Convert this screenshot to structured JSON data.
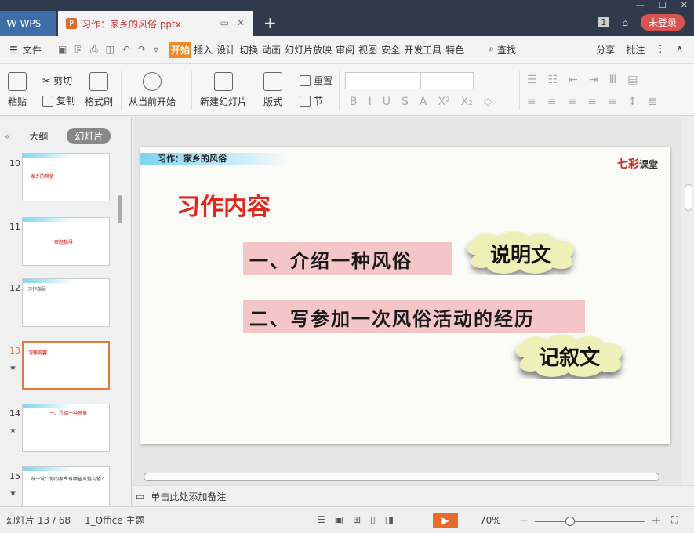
{
  "titlebar": {
    "app_tab": "WPS",
    "doc_tab": "习作：家乡的风俗.pptx",
    "badge": "1",
    "login": "未登录"
  },
  "menu": {
    "file": "文件",
    "tabs": [
      "开始",
      "插入",
      "设计",
      "切换",
      "动画",
      "幻灯片放映",
      "审阅",
      "视图",
      "安全",
      "开发工具",
      "特色"
    ],
    "active_tab": "开始",
    "find": "查找",
    "share": "分享",
    "comment": "批注"
  },
  "ribbon": {
    "paste": "粘贴",
    "cut": "剪切",
    "copy": "复制",
    "format_painter": "格式刷",
    "from_current": "从当前开始",
    "new_slide": "新建幻灯片",
    "layout": "版式",
    "reset": "重置",
    "section": "节"
  },
  "left_panel": {
    "tab_outline": "大纲",
    "tab_slides": "幻灯片",
    "thumbnails": [
      {
        "num": "10",
        "text": "家乡的风俗"
      },
      {
        "num": "11",
        "text": "审题指导"
      },
      {
        "num": "12",
        "text": "习作指导"
      },
      {
        "num": "13",
        "text": "习作内容"
      },
      {
        "num": "14",
        "text": "一、介绍一种风俗"
      },
      {
        "num": "15",
        "text": "说一说：你的家乡有哪些风俗习俗？"
      }
    ]
  },
  "slide": {
    "header": "习作：家乡的风俗",
    "logo_main": "七彩",
    "logo_sub": "课堂",
    "title": "习作内容",
    "item1": "一、介绍一种风俗",
    "item2": "二、写参加一次风俗活动的经历",
    "cloud1": "说明文",
    "cloud2": "记叙文"
  },
  "notes": "单击此处添加备注",
  "status": {
    "slide_count": "幻灯片 13 / 68",
    "theme": "1_Office 主题",
    "zoom": "70%"
  },
  "colors": {
    "accent_orange": "#f08a24",
    "title_red": "#e0261d",
    "item_pink": "#f5c6c8",
    "cloud_fill": "#eef0b8"
  }
}
